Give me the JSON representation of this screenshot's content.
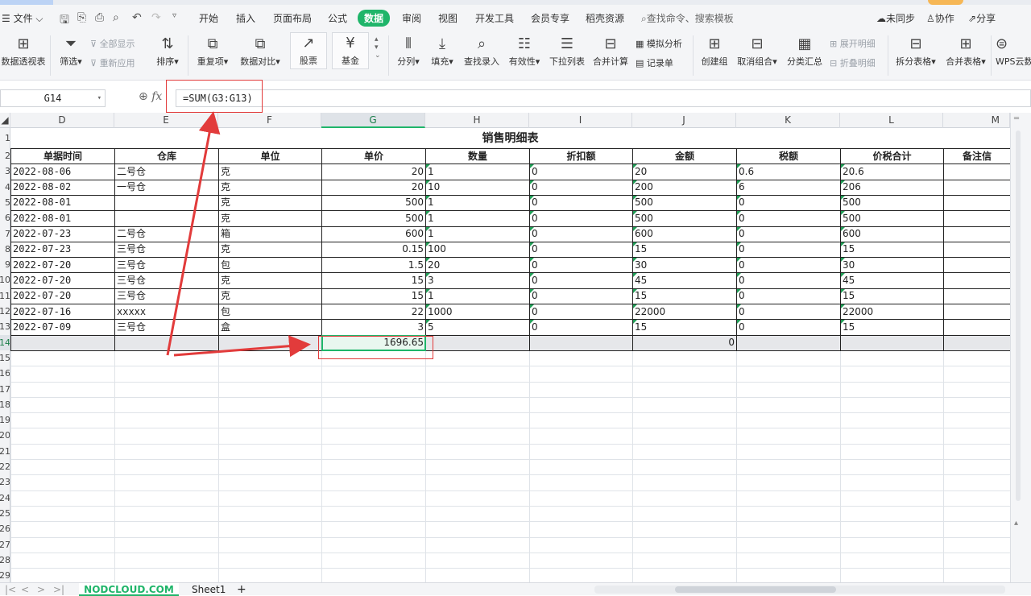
{
  "menubar": {
    "file_label": "文件",
    "tabs": [
      "开始",
      "插入",
      "页面布局",
      "公式",
      "数据",
      "审阅",
      "视图",
      "开发工具",
      "会员专享",
      "稻壳资源"
    ],
    "active_tab": "数据",
    "search_placeholder": "查找命令、搜索模板",
    "sync_label": "未同步",
    "collab_label": "协作",
    "share_label": "分享"
  },
  "ribbon": {
    "pivot": "数据透视表",
    "filter": "筛选",
    "show_all": "全部显示",
    "reapply": "重新应用",
    "sort": "排序",
    "duplicates": "重复项",
    "compare": "数据对比",
    "stocks": "股票",
    "fund": "基金",
    "split_column": "分列",
    "fill": "填充",
    "find_entry": "查找录入",
    "validity": "有效性",
    "dropdown_list": "下拉列表",
    "merge_calc": "合并计算",
    "simulate": "模拟分析",
    "record": "记录单",
    "create_group": "创建组",
    "ungroup": "取消组合",
    "subtotal": "分类汇总",
    "expand": "展开明细",
    "collapse": "折叠明细",
    "split_table": "拆分表格",
    "merge_table": "合并表格",
    "wps_cloud": "WPS云数"
  },
  "formula_bar": {
    "cell_ref": "G14",
    "fx_label": "fx",
    "formula": "=SUM(G3:G13)"
  },
  "columns": [
    "D",
    "E",
    "F",
    "G",
    "H",
    "I",
    "J",
    "K",
    "L",
    "M"
  ],
  "selected_column": "G",
  "row_numbers": [
    "1",
    "2",
    "3",
    "4",
    "5",
    "6",
    "7",
    "8",
    "9",
    "10",
    "11",
    "12",
    "13",
    "14",
    "15",
    "16",
    "17",
    "18",
    "19",
    "20",
    "21",
    "22",
    "23",
    "24",
    "25",
    "26",
    "27",
    "28",
    "29"
  ],
  "sheet": {
    "title": "销售明细表",
    "headers": [
      "单据时间",
      "仓库",
      "单位",
      "单价",
      "数量",
      "折扣额",
      "金额",
      "税额",
      "价税合计",
      "备注信"
    ],
    "rows": [
      [
        "2022-08-06",
        "二号仓",
        "克",
        "20",
        "1",
        "0",
        "20",
        "0.6",
        "20.6"
      ],
      [
        "2022-08-02",
        "一号仓",
        "克",
        "20",
        "10",
        "0",
        "200",
        "6",
        "206"
      ],
      [
        "2022-08-01",
        "",
        "克",
        "500",
        "1",
        "0",
        "500",
        "0",
        "500"
      ],
      [
        "2022-08-01",
        "",
        "克",
        "500",
        "1",
        "0",
        "500",
        "0",
        "500"
      ],
      [
        "2022-07-23",
        "二号仓",
        "箱",
        "600",
        "1",
        "0",
        "600",
        "0",
        "600"
      ],
      [
        "2022-07-23",
        "三号仓",
        "克",
        "0.15",
        "100",
        "0",
        "15",
        "0",
        "15"
      ],
      [
        "2022-07-20",
        "三号仓",
        "包",
        "1.5",
        "20",
        "0",
        "30",
        "0",
        "30"
      ],
      [
        "2022-07-20",
        "三号仓",
        "克",
        "15",
        "3",
        "0",
        "45",
        "0",
        "45"
      ],
      [
        "2022-07-20",
        "三号仓",
        "克",
        "15",
        "1",
        "0",
        "15",
        "0",
        "15"
      ],
      [
        "2022-07-16",
        "xxxxx",
        "包",
        "22",
        "1000",
        "0",
        "22000",
        "0",
        "22000"
      ],
      [
        "2022-07-09",
        "三号仓",
        "盒",
        "3",
        "5",
        "0",
        "15",
        "0",
        "15"
      ]
    ],
    "sum_value": "1696.65",
    "sum_j": "0"
  },
  "tabs_bar": {
    "sheet_label": "NODCLOUD.COM",
    "sheet1": "Sheet1",
    "add": "+"
  },
  "colors": {
    "accent": "#1fb56a",
    "annotation": "#e23b3b"
  }
}
